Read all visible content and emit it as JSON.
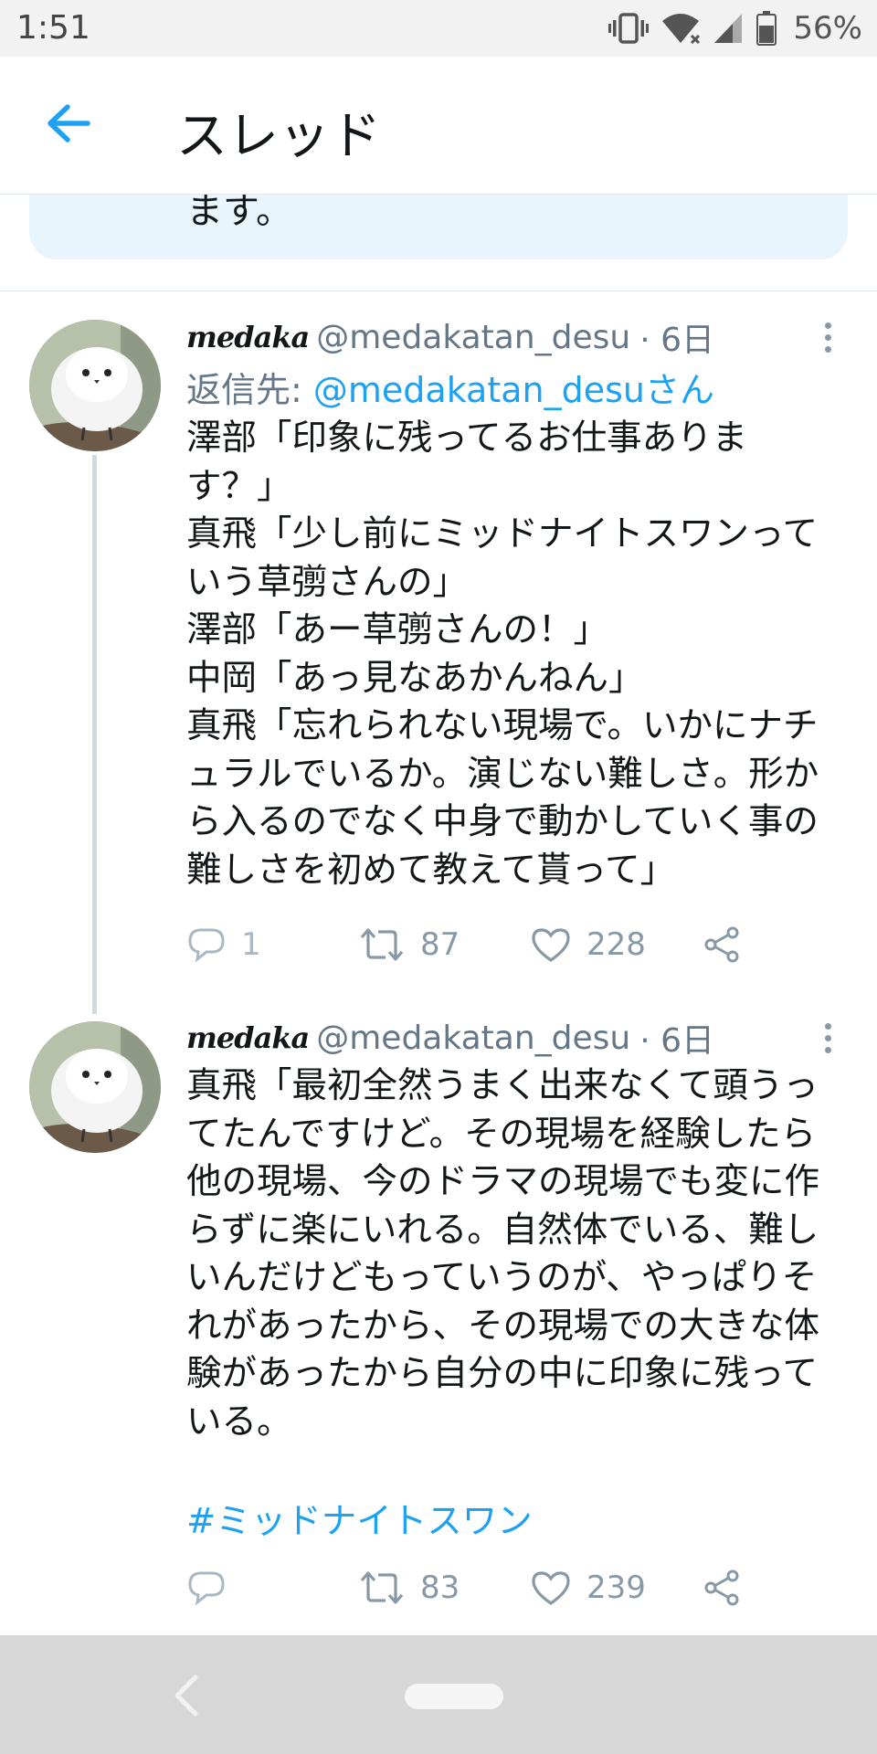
{
  "status_bar": {
    "time": "1:51",
    "battery_percent": "56%",
    "icons": [
      "vibrate-icon",
      "wifi-icon",
      "signal-icon",
      "battery-icon"
    ]
  },
  "app_bar": {
    "title": "スレッド",
    "back_icon": "arrow-left-icon"
  },
  "previous_tweet": {
    "visible_text": "ます。"
  },
  "tweets": [
    {
      "name": "medaka",
      "handle": "@medakatan_desu",
      "time": "· 6日",
      "reply_label": "返信先: ",
      "reply_handle": "@medakatan_desuさん",
      "lines": [
        "澤部「印象に残ってるお仕事ありま",
        "す？」",
        "真飛「少し前にミッドナイトスワンって",
        "いう草彅さんの」",
        "澤部「あー草彅さんの！」",
        "中岡「あっ見なあかんねん」",
        "真飛「忘れられない現場で。いかにナチ",
        "ュラルでいるか。演じない難しさ。形か",
        "ら入るのでなく中身で動かしていく事の",
        "難しさを初めて教えて貰って」"
      ],
      "replies": "1",
      "retweets": "87",
      "likes": "228"
    },
    {
      "name": "medaka",
      "handle": "@medakatan_desu",
      "time": "· 6日",
      "lines": [
        "真飛「最初全然うまく出来なくて頭うっ",
        "てたんですけど。その現場を経験したら",
        "他の現場、今のドラマの現場でも変に作",
        "らずに楽にいれる。自然体でいる、難し",
        "いんだけどもっていうのが、やっぱりそ",
        "れがあったから、その現場での大きな体",
        "験があったから自分の中に印象に残って",
        "いる。"
      ],
      "hashtag": "#ミッドナイトスワン",
      "replies": "",
      "retweets": "83",
      "likes": "239"
    }
  ],
  "colors": {
    "accent": "#1da1f2",
    "secondary_text": "#657786",
    "card_bg": "#e8f5fd",
    "nav_bar": "#d7d7d7"
  }
}
